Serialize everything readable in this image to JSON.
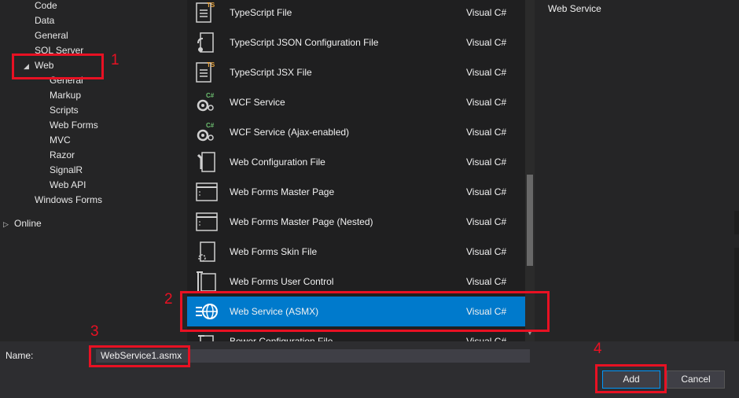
{
  "tree": {
    "items": [
      {
        "label": "Code",
        "arrow": ""
      },
      {
        "label": "Data",
        "arrow": ""
      },
      {
        "label": "General",
        "arrow": ""
      },
      {
        "label": "SQL Server",
        "arrow": ""
      },
      {
        "label": "Web",
        "arrow": "◢"
      },
      {
        "label": "General",
        "arrow": ""
      },
      {
        "label": "Markup",
        "arrow": ""
      },
      {
        "label": "Scripts",
        "arrow": ""
      },
      {
        "label": "Web Forms",
        "arrow": ""
      },
      {
        "label": "MVC",
        "arrow": ""
      },
      {
        "label": "Razor",
        "arrow": ""
      },
      {
        "label": "SignalR",
        "arrow": ""
      },
      {
        "label": "Web API",
        "arrow": ""
      },
      {
        "label": "Windows Forms",
        "arrow": ""
      },
      {
        "label": "Online",
        "arrow": "▷"
      }
    ]
  },
  "templates": [
    {
      "name": "TypeScript File",
      "lang": "Visual C#",
      "icon": "typescript-file-icon"
    },
    {
      "name": "TypeScript JSON Configuration File",
      "lang": "Visual C#",
      "icon": "json-config-icon"
    },
    {
      "name": "TypeScript JSX File",
      "lang": "Visual C#",
      "icon": "typescript-jsx-icon"
    },
    {
      "name": "WCF Service",
      "lang": "Visual C#",
      "icon": "wcf-service-icon"
    },
    {
      "name": "WCF Service (Ajax-enabled)",
      "lang": "Visual C#",
      "icon": "wcf-ajax-icon"
    },
    {
      "name": "Web Configuration File",
      "lang": "Visual C#",
      "icon": "web-config-icon"
    },
    {
      "name": "Web Forms Master Page",
      "lang": "Visual C#",
      "icon": "master-page-icon"
    },
    {
      "name": "Web Forms Master Page (Nested)",
      "lang": "Visual C#",
      "icon": "nested-master-page-icon"
    },
    {
      "name": "Web Forms Skin File",
      "lang": "Visual C#",
      "icon": "skin-file-icon"
    },
    {
      "name": "Web Forms User Control",
      "lang": "Visual C#",
      "icon": "user-control-icon"
    },
    {
      "name": "Web Service (ASMX)",
      "lang": "Visual C#",
      "icon": "web-service-icon"
    },
    {
      "name": "Bower Configuration File",
      "lang": "Visual C#",
      "icon": "bower-config-icon"
    }
  ],
  "description": {
    "text": "Web Service"
  },
  "name_field": {
    "label": "Name:",
    "value": "WebService1.asmx"
  },
  "buttons": {
    "add": "Add",
    "cancel": "Cancel"
  },
  "annotations": {
    "one": "1",
    "two": "2",
    "three": "3",
    "four": "4"
  },
  "colors": {
    "accent": "#007acc",
    "highlight": "#e81123",
    "background": "#2d2d30"
  }
}
